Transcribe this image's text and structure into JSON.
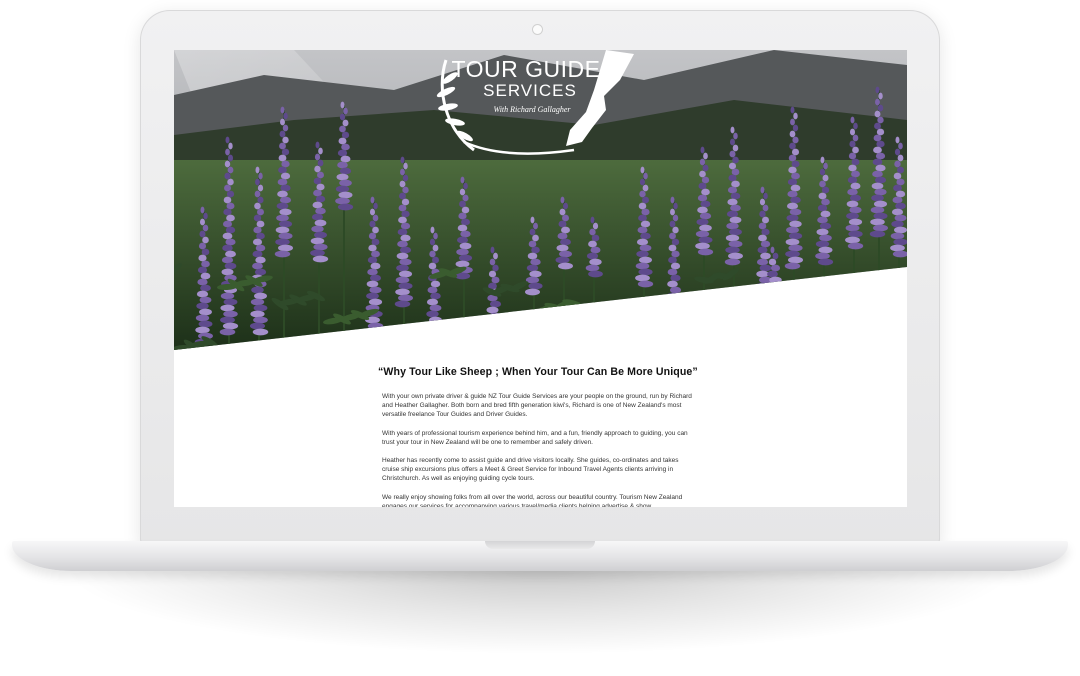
{
  "logo": {
    "line1": "TOUR GUIDE",
    "line2": "SERVICES",
    "tagline": "With Richard Gallagher"
  },
  "hero": {
    "image_alt": "purple lupin flowers in a mountain valley"
  },
  "content": {
    "headline": "“Why Tour Like Sheep ; When Your Tour Can Be More Unique”",
    "paragraphs": [
      "With your own private driver & guide NZ Tour Guide Services are your people on the ground, run by Richard and Heather Gallagher. Both born and bred fifth generation kiwi's, Richard is one of New Zealand's most versatile freelance Tour Guides and Driver Guides.",
      "With years of professional tourism experience behind him, and a fun, friendly approach to guiding, you can trust your tour in New Zealand will be one to remember and safely driven.",
      "Heather has recently come to assist guide and drive visitors locally. She guides, co-ordinates and takes cruise ship excursions plus offers a Meet & Greet Service for Inbound Travel Agents clients arriving in Christchurch. As well as enjoying guiding cycle tours.",
      "We really enjoy showing folks from all over the world, across our beautiful country. Tourism New Zealand engages our services for accompanying various travel/media clients helping advertise & show"
    ]
  },
  "colors": {
    "lupin_purple": "#7a62a8",
    "sky": "#aeb1b6",
    "foliage": "#2f4a2a"
  }
}
